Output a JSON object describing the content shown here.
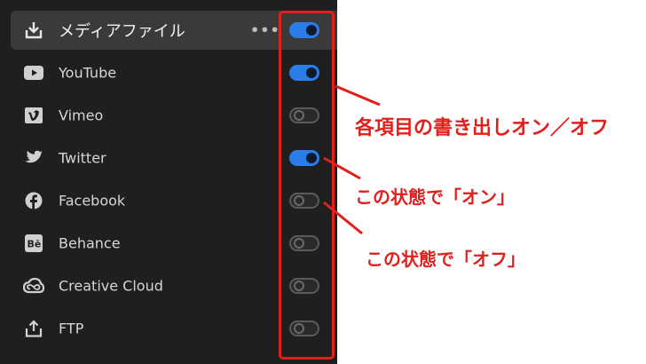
{
  "panel": {
    "items": [
      {
        "label": "メディアファイル",
        "icon": "download-icon",
        "toggle": "on",
        "more": "•••"
      },
      {
        "label": "YouTube",
        "icon": "youtube-icon",
        "toggle": "on"
      },
      {
        "label": "Vimeo",
        "icon": "vimeo-icon",
        "toggle": "off"
      },
      {
        "label": "Twitter",
        "icon": "twitter-icon",
        "toggle": "on"
      },
      {
        "label": "Facebook",
        "icon": "facebook-icon",
        "toggle": "off"
      },
      {
        "label": "Behance",
        "icon": "behance-icon",
        "toggle": "off"
      },
      {
        "label": "Creative Cloud",
        "icon": "creative-cloud-icon",
        "toggle": "off"
      },
      {
        "label": "FTP",
        "icon": "upload-icon",
        "toggle": "off"
      }
    ]
  },
  "annotations": {
    "main": "各項目の書き出しオン／オフ",
    "on_state": "この状態で「オン」",
    "off_state": "この状態で「オフ」"
  },
  "colors": {
    "panel_bg": "#1f1f1f",
    "toggle_on": "#2b7de9",
    "annotation_red": "#e0201c"
  }
}
